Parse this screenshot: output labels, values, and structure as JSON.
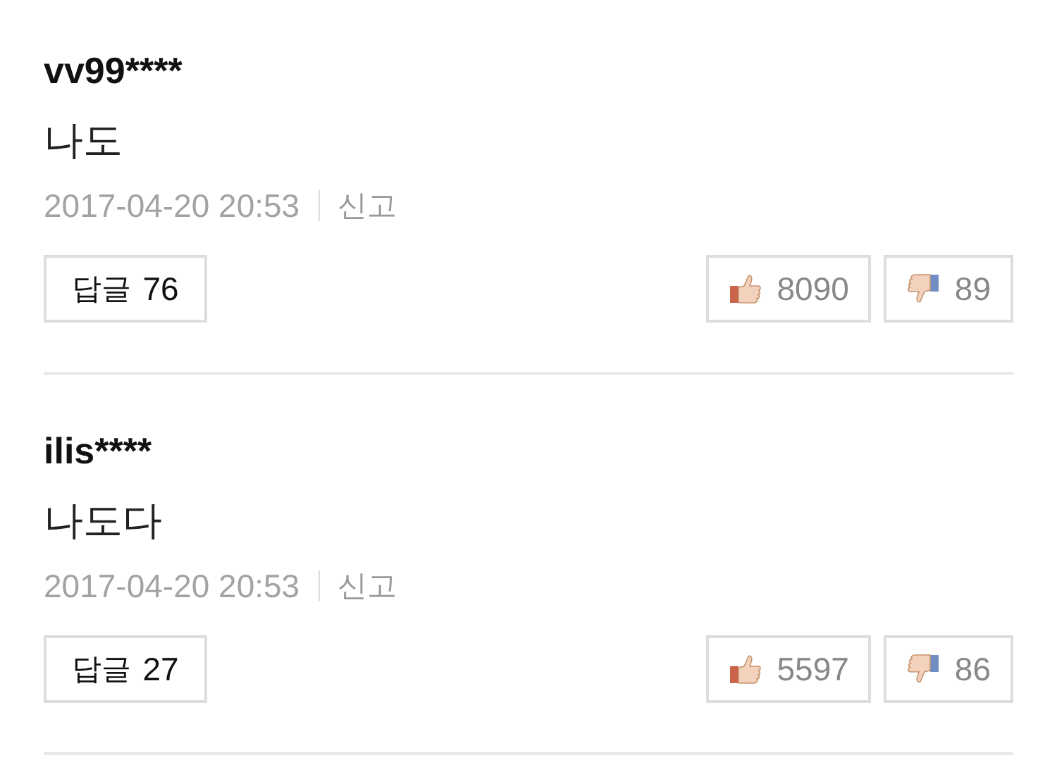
{
  "comments": [
    {
      "user": "vv99****",
      "text": "나도",
      "date": "2017-04-20 20:53",
      "report": "신고",
      "reply": {
        "label": "답글",
        "count": "76"
      },
      "likes": "8090",
      "dislikes": "89"
    },
    {
      "user": "ilis****",
      "text": "나도다",
      "date": "2017-04-20 20:53",
      "report": "신고",
      "reply": {
        "label": "답글",
        "count": "27"
      },
      "likes": "5597",
      "dislikes": "86"
    }
  ]
}
